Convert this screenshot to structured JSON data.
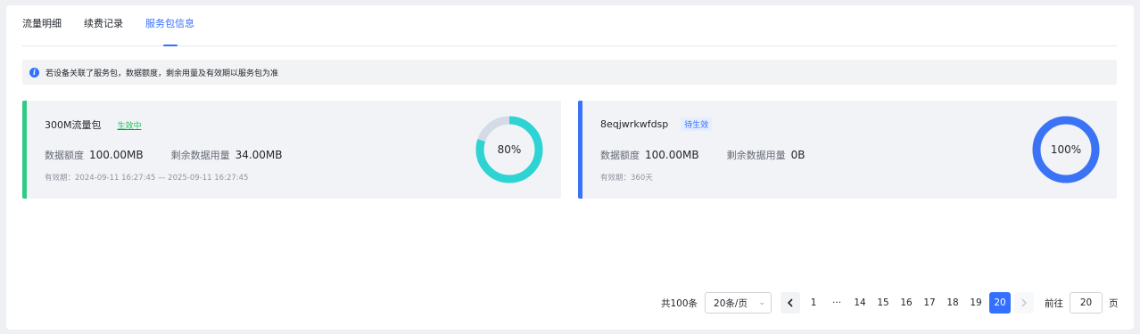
{
  "tabs": [
    {
      "label": "流量明细",
      "active": false
    },
    {
      "label": "续费记录",
      "active": false
    },
    {
      "label": "服务包信息",
      "active": true
    }
  ],
  "notice": {
    "icon": "info-icon",
    "text": "若设备关联了服务包，数据额度，剩余用量及有效期以服务包为准"
  },
  "cards": [
    {
      "name": "300M流量包",
      "status": "生效中",
      "quota_label": "数据额度",
      "quota_value": "100.00MB",
      "remain_label": "剩余数据用量",
      "remain_value": "34.00MB",
      "validity": "有效期：2024-09-11 16:27:45 — 2025-09-11 16:27:45",
      "progress_label": "80%",
      "progress_fraction": 0.8,
      "accent_color": "#2fcb84",
      "ring_color": "#2ed3d3",
      "ring_track_color": "#d4dbe6"
    },
    {
      "name": "8eqjwrkwfdsp",
      "status": "待生效",
      "quota_label": "数据额度",
      "quota_value": "100.00MB",
      "remain_label": "剩余数据用量",
      "remain_value": "0B",
      "validity": "有效期：360天",
      "progress_label": "100%",
      "progress_fraction": 1.0,
      "accent_color": "#3b73f6",
      "ring_color": "#3b73f6",
      "ring_track_color": "#d4dbe6"
    }
  ],
  "pagination": {
    "total": "共100条",
    "page_size": "20条/页",
    "prev_icon": "chevron-left-icon",
    "next_icon": "chevron-right-icon",
    "pages": [
      "1",
      "···",
      "14",
      "15",
      "16",
      "17",
      "18",
      "19",
      "20"
    ],
    "current": "20",
    "goto_label": "前往",
    "goto_value": "20",
    "page_suffix": "页"
  }
}
